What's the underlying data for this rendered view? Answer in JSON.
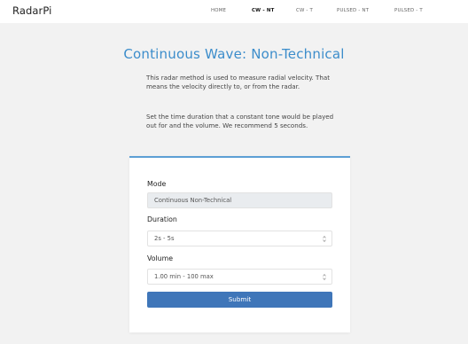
{
  "navbar": {
    "brand": "RadarPi",
    "links": [
      {
        "label": "HOME",
        "active": false
      },
      {
        "label": "CW - NT",
        "active": true
      },
      {
        "label": "CW - T",
        "active": false
      },
      {
        "label": "PULSED - NT",
        "active": false
      },
      {
        "label": "PULSED - T",
        "active": false
      }
    ]
  },
  "page": {
    "title": "Continuous Wave: Non-Technical",
    "intro": "This radar method is used to measure radial velocity. That means the velocity directly to, or from the radar.",
    "instructions": "Set the time duration that a constant tone would be played out for and the volume. We recommend 5 seconds."
  },
  "form": {
    "mode_label": "Mode",
    "mode_value": "Continuous Non-Technical",
    "duration_label": "Duration",
    "duration_value": "2s - 5s",
    "volume_label": "Volume",
    "volume_value": "1.00 min - 100 max",
    "submit_label": "Submit"
  },
  "colors": {
    "accent_title": "#3c8dcb",
    "button": "#3f76b9",
    "card_top_border": "#5d9fd5",
    "background": "#f2f2f2"
  },
  "icons": {
    "number_spinner": "spinner-arrows-icon"
  }
}
